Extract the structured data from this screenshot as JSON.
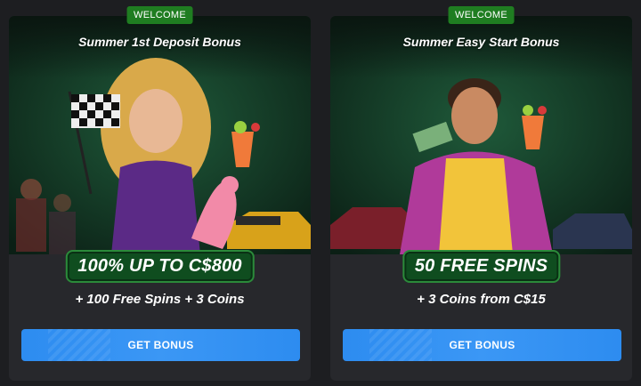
{
  "cards": [
    {
      "badge": "WELCOME",
      "title": "Summer 1st Deposit Bonus",
      "headline": "100% UP TO C$800",
      "subtext": "+ 100 Free Spins + 3 Coins",
      "button": "GET BONUS"
    },
    {
      "badge": "WELCOME",
      "title": "Summer Easy Start Bonus",
      "headline": "50 FREE SPINS",
      "subtext": "+ 3 Coins from C$15",
      "button": "GET BONUS"
    }
  ],
  "colors": {
    "badge_bg": "#1f7d21",
    "button_bg": "#2d8cf0",
    "card_bg": "#27282c",
    "headline_bg": "#0f4d1f"
  }
}
